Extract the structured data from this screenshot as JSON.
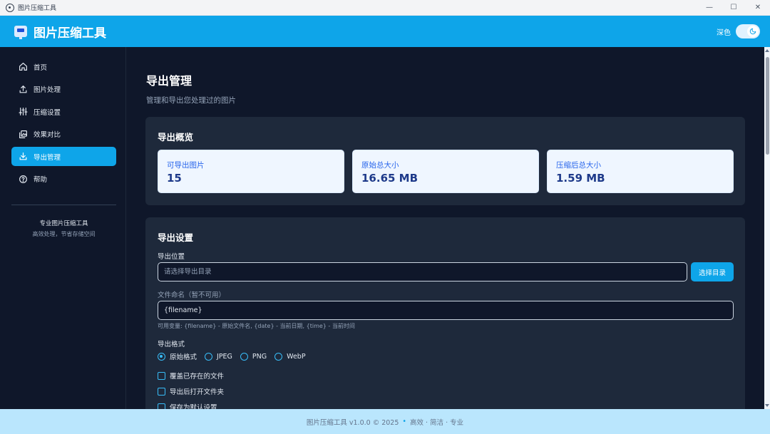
{
  "window": {
    "title": "图片压缩工具",
    "controls": {
      "minimize": "—",
      "maximize": "☐",
      "close": "✕"
    }
  },
  "header": {
    "app_title": "图片压缩工具",
    "theme_label": "深色",
    "theme_dark": true
  },
  "sidebar": {
    "items": [
      {
        "label": "首页",
        "icon": "home-icon",
        "active": false
      },
      {
        "label": "图片处理",
        "icon": "upload-icon",
        "active": false
      },
      {
        "label": "压缩设置",
        "icon": "sliders-icon",
        "active": false
      },
      {
        "label": "效果对比",
        "icon": "compare-image-icon",
        "active": false
      },
      {
        "label": "导出管理",
        "icon": "download-icon",
        "active": true
      },
      {
        "label": "帮助",
        "icon": "help-icon",
        "active": false
      }
    ],
    "promo_title": "专业图片压缩工具",
    "promo_subtitle": "高效处理，节省存储空间"
  },
  "main": {
    "page_title": "导出管理",
    "page_subtitle": "管理和导出您处理过的图片",
    "overview": {
      "title": "导出概览",
      "stats": [
        {
          "label": "可导出图片",
          "value": "15"
        },
        {
          "label": "原始总大小",
          "value": "16.65 MB"
        },
        {
          "label": "压缩后总大小",
          "value": "1.59 MB"
        }
      ]
    },
    "settings": {
      "title": "导出设置",
      "location_label": "导出位置",
      "location_placeholder": "请选择导出目录",
      "location_value": "",
      "choose_dir_button": "选择目录",
      "naming_label": "文件命名（暂不可用）",
      "naming_value": "{filename}",
      "naming_hint": "可用变量: {filename} - 原始文件名, {date} - 当前日期, {time} - 当前时间",
      "format_label": "导出格式",
      "formats": [
        {
          "label": "原始格式",
          "checked": true
        },
        {
          "label": "JPEG",
          "checked": false
        },
        {
          "label": "PNG",
          "checked": false
        },
        {
          "label": "WebP",
          "checked": false
        }
      ],
      "options": [
        {
          "label": "覆盖已存在的文件",
          "checked": false
        },
        {
          "label": "导出后打开文件夹",
          "checked": false
        },
        {
          "label": "保存为默认设置",
          "checked": false
        }
      ]
    }
  },
  "footer": {
    "version_text": "图片压缩工具 v1.0.0 © 2025",
    "separator": "•",
    "tagline": "高效 · 简洁 · 专业"
  },
  "colors": {
    "accent": "#0ea5e9",
    "background": "#0f172a",
    "card": "#1e293b",
    "stat_card": "#eff6ff",
    "footer": "#bae6fd"
  }
}
